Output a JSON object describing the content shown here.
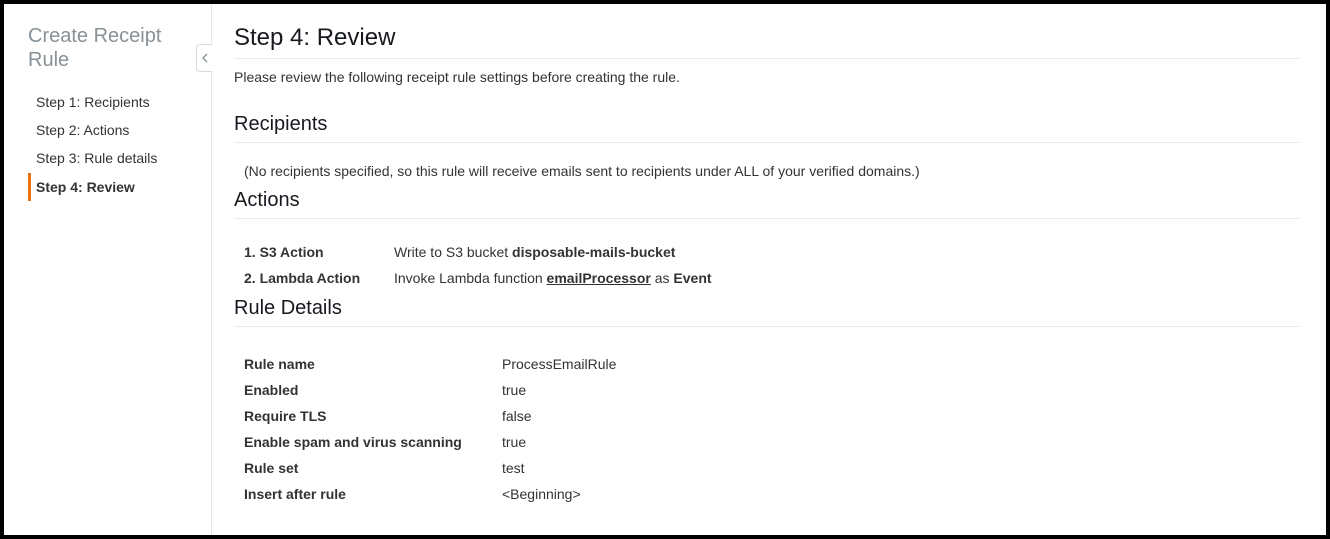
{
  "sidebar": {
    "title": "Create Receipt Rule",
    "items": [
      {
        "label": "Step 1: Recipients",
        "active": false
      },
      {
        "label": "Step 2: Actions",
        "active": false
      },
      {
        "label": "Step 3: Rule details",
        "active": false
      },
      {
        "label": "Step 4: Review",
        "active": true
      }
    ]
  },
  "main": {
    "title": "Step 4: Review",
    "intro": "Please review the following receipt rule settings before creating the rule.",
    "recipients": {
      "heading": "Recipients",
      "note": "(No recipients specified, so this rule will receive emails sent to recipients under ALL of your verified domains.)"
    },
    "actions": {
      "heading": "Actions",
      "items": [
        {
          "label": "1. S3 Action",
          "pre": "Write to S3 bucket ",
          "target": "disposable-mails-bucket",
          "target_class": "bold",
          "post": ""
        },
        {
          "label": "2. Lambda Action",
          "pre": "Invoke Lambda function ",
          "target": "emailProcessor",
          "target_class": "link",
          "post_pre": " as ",
          "post_bold": "Event"
        }
      ]
    },
    "rule_details": {
      "heading": "Rule Details",
      "rows": [
        {
          "label": "Rule name",
          "value": "ProcessEmailRule"
        },
        {
          "label": "Enabled",
          "value": "true"
        },
        {
          "label": "Require TLS",
          "value": "false"
        },
        {
          "label": "Enable spam and virus scanning",
          "value": "true"
        },
        {
          "label": "Rule set",
          "value": "test"
        },
        {
          "label": "Insert after rule",
          "value": "<Beginning>"
        }
      ]
    }
  }
}
